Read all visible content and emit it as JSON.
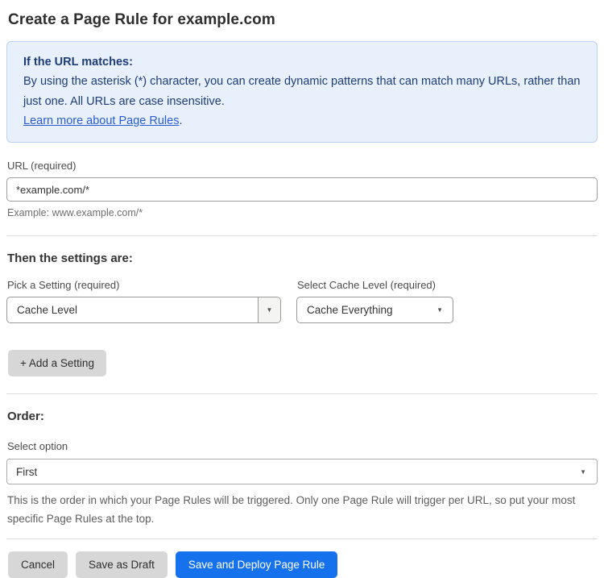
{
  "page": {
    "title": "Create a Page Rule for example.com"
  },
  "info_box": {
    "heading": "If the URL matches:",
    "body": "By using the asterisk (*) character, you can create dynamic patterns that can match many URLs, rather than just one. All URLs are case insensitive.",
    "link_label": "Learn more about Page Rules",
    "link_suffix": "."
  },
  "url_field": {
    "label": "URL (required)",
    "value": "*example.com/*",
    "helper": "Example: www.example.com/*"
  },
  "settings_section": {
    "heading": "Then the settings are:",
    "setting_select": {
      "label": "Pick a Setting (required)",
      "value": "Cache Level"
    },
    "cache_level_select": {
      "label": "Select Cache Level (required)",
      "value": "Cache Everything"
    },
    "add_setting_label": "+ Add a Setting"
  },
  "order_section": {
    "heading": "Order:",
    "select_label": "Select option",
    "select_value": "First",
    "help_text": "This is the order in which your Page Rules will be triggered. Only one Page Rule will trigger per URL, so put your most specific Page Rules at the top."
  },
  "footer": {
    "cancel_label": "Cancel",
    "save_draft_label": "Save as Draft",
    "save_deploy_label": "Save and Deploy Page Rule"
  },
  "icons": {
    "dropdown_caret": "▼"
  },
  "colors": {
    "info_background": "#e8f1fb",
    "info_border": "#b9d2ee",
    "info_text": "#1e3c78",
    "link": "#2a5bd7",
    "primary_button": "#1672ec",
    "secondary_button": "#d7d7d7"
  }
}
